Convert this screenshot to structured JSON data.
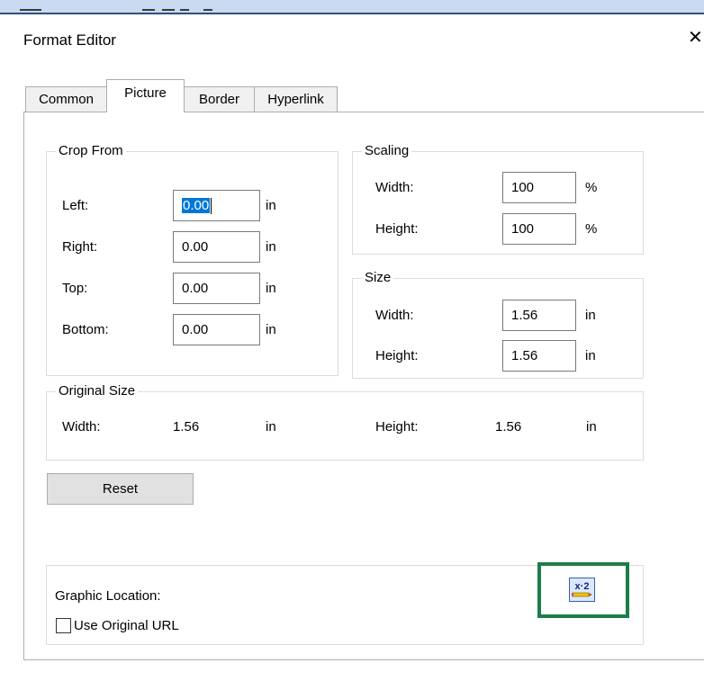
{
  "window": {
    "title": "Format Editor",
    "close_glyph": "✕"
  },
  "tabs": [
    {
      "label": "Common",
      "active": false
    },
    {
      "label": "Picture",
      "active": true
    },
    {
      "label": "Border",
      "active": false
    },
    {
      "label": "Hyperlink",
      "active": false
    }
  ],
  "crop_from": {
    "legend": "Crop From",
    "left": {
      "label": "Left:",
      "value": "0.00",
      "unit": "in"
    },
    "right": {
      "label": "Right:",
      "value": "0.00",
      "unit": "in"
    },
    "top": {
      "label": "Top:",
      "value": "0.00",
      "unit": "in"
    },
    "bottom": {
      "label": "Bottom:",
      "value": "0.00",
      "unit": "in"
    }
  },
  "scaling": {
    "legend": "Scaling",
    "width": {
      "label": "Width:",
      "value": "100",
      "unit": "%"
    },
    "height": {
      "label": "Height:",
      "value": "100",
      "unit": "%"
    }
  },
  "size": {
    "legend": "Size",
    "width": {
      "label": "Width:",
      "value": "1.56",
      "unit": "in"
    },
    "height": {
      "label": "Height:",
      "value": "1.56",
      "unit": "in"
    }
  },
  "original_size": {
    "legend": "Original Size",
    "width": {
      "label": "Width:",
      "value": "1.56",
      "unit": "in"
    },
    "height": {
      "label": "Height:",
      "value": "1.56",
      "unit": "in"
    }
  },
  "reset_label": "Reset",
  "graphic": {
    "location_label": "Graphic Location:",
    "use_original_url_label": "Use Original URL",
    "use_original_url_checked": false,
    "icon": "graphic-formula-icon",
    "icon_text": "x·2"
  },
  "colors": {
    "selection": "#0078d7",
    "highlight_border": "#1d7d4a",
    "top_strip": "#c9d9ef"
  }
}
